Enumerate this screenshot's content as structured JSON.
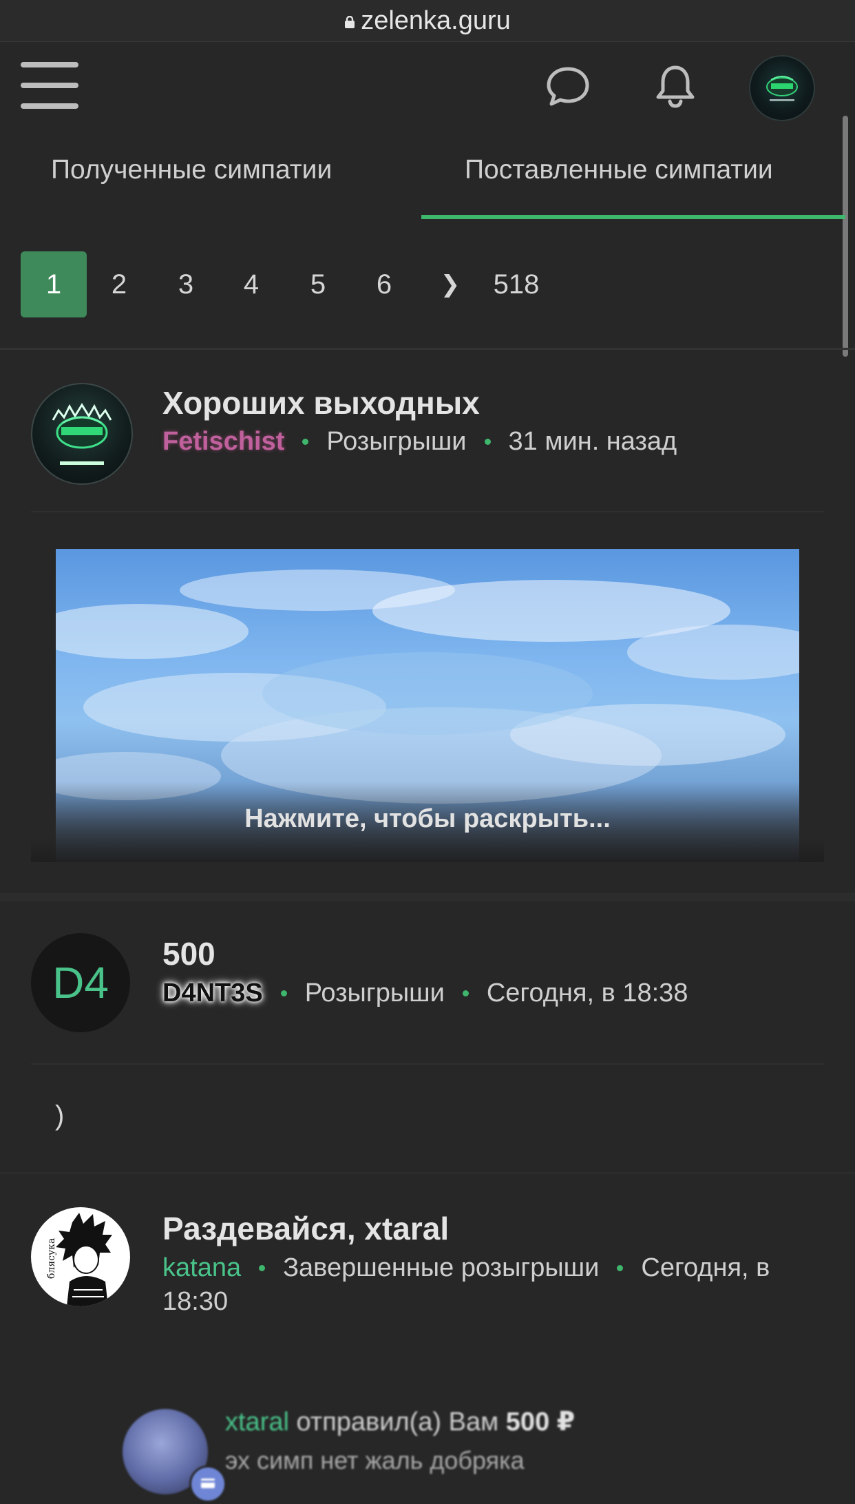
{
  "browser": {
    "url": "zelenka.guru",
    "lock_icon": "lock-icon"
  },
  "header": {
    "menu_icon": "hamburger-menu-icon",
    "chat_icon": "chat-bubble-icon",
    "notifications_icon": "bell-icon",
    "avatar_icon": "user-avatar"
  },
  "tabs": [
    {
      "label": "Полученные симпатии",
      "active": false
    },
    {
      "label": "Поставленные симпатии",
      "active": true
    }
  ],
  "pagination": {
    "pages": [
      "1",
      "2",
      "3",
      "4",
      "5",
      "6"
    ],
    "next": "❯",
    "last": "518",
    "current": "1"
  },
  "posts": [
    {
      "title": "Хороших выходных",
      "author": "Fetischist",
      "forum": "Розыгрыши",
      "time": "31 мин. назад",
      "expand_label": "Нажмите, чтобы раскрыть..."
    },
    {
      "title": "500",
      "avatar_text": "D4",
      "author": "D4NT3S",
      "forum": "Розыгрыши",
      "time": "Сегодня, в 18:38",
      "body": ")"
    },
    {
      "title": "Раздевайся, xtaral",
      "author": "katana",
      "forum": "Завершенные розыгрыши",
      "time_line1": "Сегодня, в",
      "time_line2": "18:30",
      "avatar_caption": "блясука",
      "notice": {
        "user": "xtaral",
        "action": "отправил(а) Вам",
        "amount": "500 ₽",
        "message": "эх симп нет жаль добряка"
      }
    }
  ],
  "colors": {
    "background": "#272727",
    "accent_green": "#3eb66c",
    "active_page": "#3e8a5a",
    "author_pink": "#c0609c",
    "author_green": "#49c38a"
  }
}
